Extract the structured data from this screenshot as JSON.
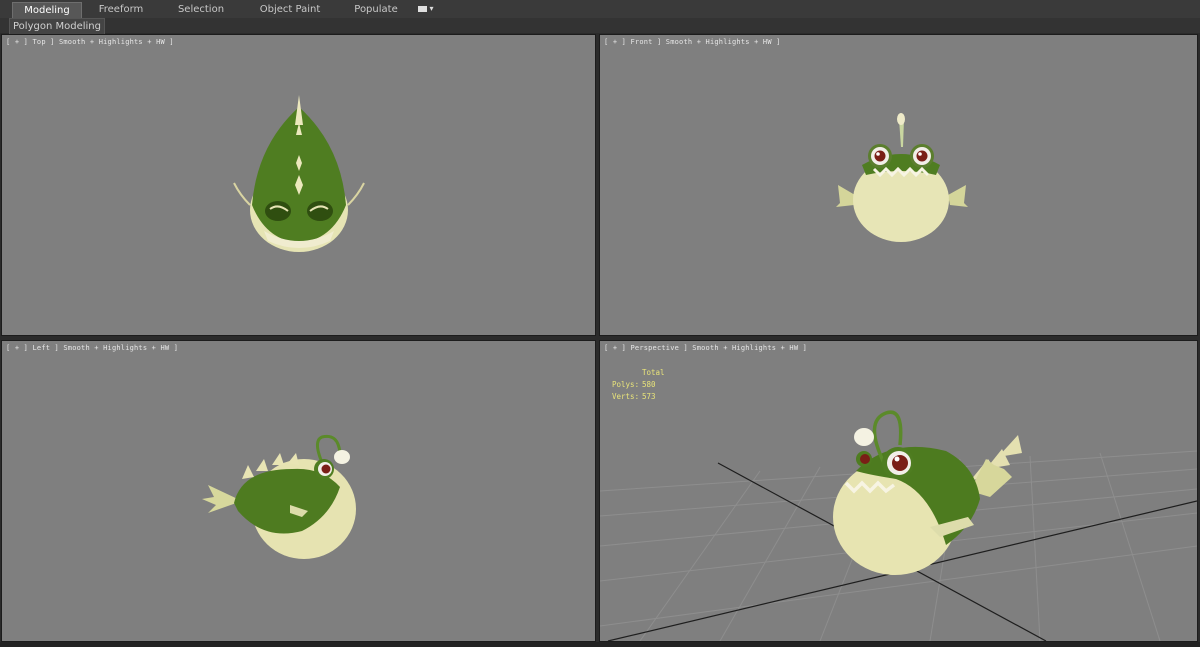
{
  "ribbon": {
    "tabs": [
      {
        "label": "Modeling",
        "active": true
      },
      {
        "label": "Freeform",
        "active": false
      },
      {
        "label": "Selection",
        "active": false
      },
      {
        "label": "Object Paint",
        "active": false
      },
      {
        "label": "Populate",
        "active": false
      }
    ],
    "sub_label": "Polygon Modeling"
  },
  "viewports": {
    "top": {
      "label": "[ + ] Top ] Smooth + Highlights + HW ]"
    },
    "front": {
      "label": "[ + ] Front ] Smooth + Highlights + HW ]"
    },
    "left": {
      "label": "[ + ] Left ] Smooth + Highlights + HW ]"
    },
    "perspective": {
      "label": "[ + ] Perspective ] Smooth + Highlights + HW ]",
      "stats": {
        "header": "Total",
        "polys_label": "Polys:",
        "polys_value": "580",
        "verts_label": "Verts:",
        "verts_value": "573"
      }
    }
  },
  "colors": {
    "viewport_bg": "#7f7f7f",
    "fish_green": "#4c7a1e",
    "fish_cream": "#e6e4b4",
    "stats_yellow": "#e9e47a"
  }
}
